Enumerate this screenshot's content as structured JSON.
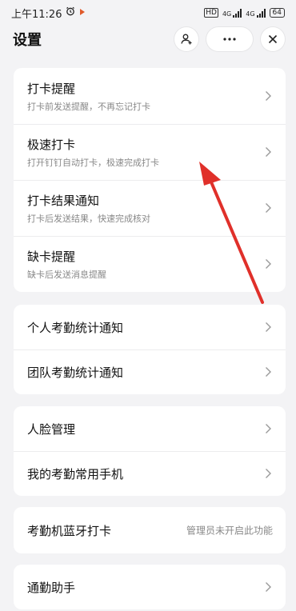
{
  "status_bar": {
    "time": "上午11:26",
    "hd": "HD",
    "signal1": "4G",
    "signal2": "4G",
    "battery": "64"
  },
  "header": {
    "title": "设置"
  },
  "group1": [
    {
      "title": "打卡提醒",
      "subtitle": "打卡前发送提醒，不再忘记打卡"
    },
    {
      "title": "极速打卡",
      "subtitle": "打开钉钉自动打卡，极速完成打卡"
    },
    {
      "title": "打卡结果通知",
      "subtitle": "打卡后发送结果，快速完成核对"
    },
    {
      "title": "缺卡提醒",
      "subtitle": "缺卡后发送消息提醒"
    }
  ],
  "group2": [
    {
      "title": "个人考勤统计通知"
    },
    {
      "title": "团队考勤统计通知"
    }
  ],
  "group3": [
    {
      "title": "人脸管理"
    },
    {
      "title": "我的考勤常用手机"
    }
  ],
  "group4": {
    "title": "考勤机蓝牙打卡",
    "note": "管理员未开启此功能"
  },
  "group5": {
    "title": "通勤助手"
  },
  "annotation": {
    "arrow_color": "#e0302a"
  }
}
